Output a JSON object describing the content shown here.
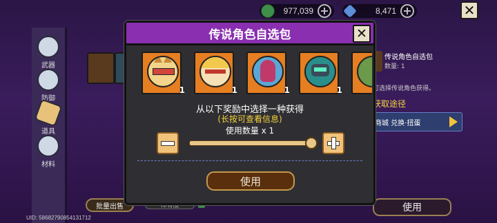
{
  "currency": {
    "coins": {
      "icon": "coin-stack-icon",
      "value": "977,039"
    },
    "gems": {
      "icon": "gem-icon",
      "value": "8,471"
    }
  },
  "sidebar": {
    "items": [
      {
        "label": "武器",
        "icon": "weapon-icon"
      },
      {
        "label": "防御",
        "icon": "shield-gear-icon"
      },
      {
        "label": "道具",
        "icon": "ticket-icon"
      },
      {
        "label": "材料",
        "icon": "puzzle-icon"
      }
    ]
  },
  "background_panel": {
    "item_name": "传说角色自选包",
    "item_count": "数量: 1",
    "desc": "可选择传说角色获得。",
    "source_title": "获取途径",
    "source_entry": "商城 兑换·扭蛋",
    "use_label": "使用",
    "bulk_sell_label": "批量出售",
    "rarity_label": "稀有度"
  },
  "dialog": {
    "title": "传说角色自选包",
    "characters": [
      {
        "name": "character-fox-goggles",
        "qty": "1"
      },
      {
        "name": "character-blonde-hero",
        "qty": "1"
      },
      {
        "name": "character-red-hood",
        "qty": "1"
      },
      {
        "name": "character-robot-green",
        "qty": "1"
      },
      {
        "name": "character-partial",
        "qty": ""
      }
    ],
    "instruction": "从以下奖励中选择一种获得",
    "hint": "(长按可查看信息)",
    "quantity_label": "使用数量 x 1",
    "slider_value": 1.0,
    "use_label": "使用"
  },
  "footer": {
    "uid": "UID: 58682790854131712"
  },
  "colors": {
    "title_bar": "#8a2fb0",
    "item_bg": "#e67e22",
    "hint": "#f5d23a"
  }
}
